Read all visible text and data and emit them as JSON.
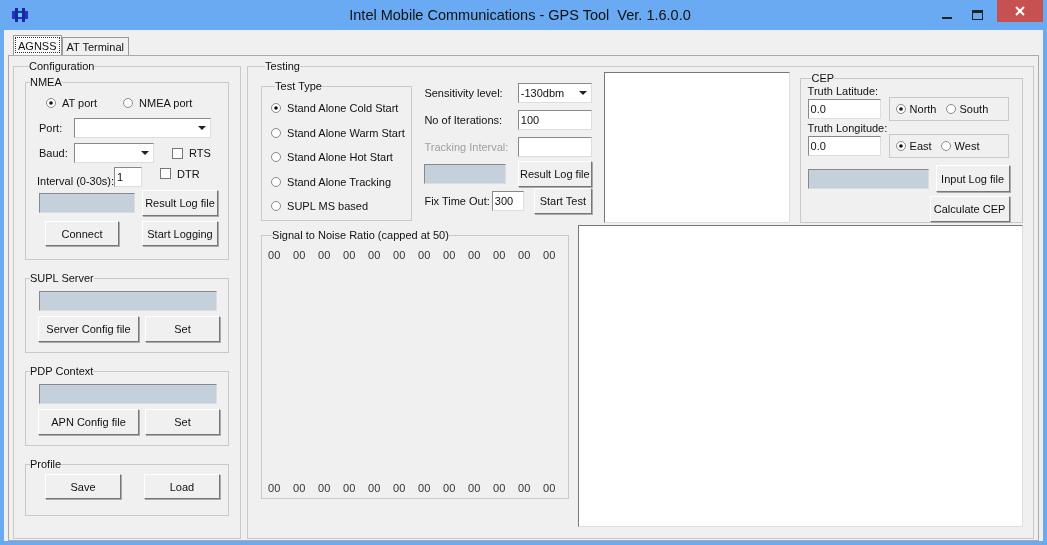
{
  "window": {
    "title": "Intel Mobile Communications - GPS Tool  Ver. 1.6.0.0"
  },
  "tabs": [
    {
      "label": "AGNSS",
      "selected": true
    },
    {
      "label": "AT Terminal",
      "selected": false
    }
  ],
  "configuration": {
    "title": "Configuration",
    "nmea": {
      "title": "NMEA",
      "ports": [
        {
          "label": "AT port",
          "selected": true
        },
        {
          "label": "NMEA port",
          "selected": false
        }
      ],
      "port_label": "Port:",
      "baud_label": "Baud:",
      "rts": {
        "label": "RTS",
        "checked": false
      },
      "dtr": {
        "label": "DTR",
        "checked": false
      },
      "interval_label": "Interval (0-30s):",
      "interval_value": "1",
      "result_log_button": "Result Log file",
      "connect_button": "Connect",
      "start_logging_button": "Start Logging"
    },
    "supl_server": {
      "title": "SUPL Server",
      "config_button": "Server Config file",
      "set_button": "Set"
    },
    "pdp_context": {
      "title": "PDP Context",
      "config_button": "APN Config file",
      "set_button": "Set"
    },
    "profile": {
      "title": "Profile",
      "save_button": "Save",
      "load_button": "Load"
    }
  },
  "testing": {
    "title": "Testing",
    "test_type": {
      "title": "Test Type",
      "options": [
        {
          "label": "Stand Alone Cold Start",
          "selected": true
        },
        {
          "label": "Stand Alone Warm Start",
          "selected": false
        },
        {
          "label": "Stand Alone Hot Start",
          "selected": false
        },
        {
          "label": "Stand Alone Tracking",
          "selected": false
        },
        {
          "label": "SUPL MS based",
          "selected": false
        }
      ]
    },
    "sensitivity": {
      "label": "Sensitivity level:",
      "value": "-130dbm"
    },
    "iterations": {
      "label": "No of Iterations:",
      "value": "100"
    },
    "tracking_interval": {
      "label": "Tracking Interval:",
      "disabled": true
    },
    "result_log_button": "Result Log file",
    "fix_time_out": {
      "label": "Fix Time Out:",
      "value": "300"
    },
    "start_test_button": "Start Test",
    "snr": {
      "title": "Signal to Noise Ratio (capped at 50)",
      "top_values": [
        "00",
        "00",
        "00",
        "00",
        "00",
        "00",
        "00",
        "00",
        "00",
        "00",
        "00",
        "00"
      ],
      "bottom_values": [
        "00",
        "00",
        "00",
        "00",
        "00",
        "00",
        "00",
        "00",
        "00",
        "00",
        "00",
        "00"
      ]
    }
  },
  "cep": {
    "title": "CEP",
    "latitude": {
      "label": "Truth Latitude:",
      "value": "0.0",
      "options": [
        {
          "label": "North",
          "selected": true
        },
        {
          "label": "South",
          "selected": false
        }
      ]
    },
    "longitude": {
      "label": "Truth Longitude:",
      "value": "0.0",
      "options": [
        {
          "label": "East",
          "selected": true
        },
        {
          "label": "West",
          "selected": false
        }
      ]
    },
    "input_log_button": "Input Log file",
    "calculate_button": "Calculate CEP"
  }
}
